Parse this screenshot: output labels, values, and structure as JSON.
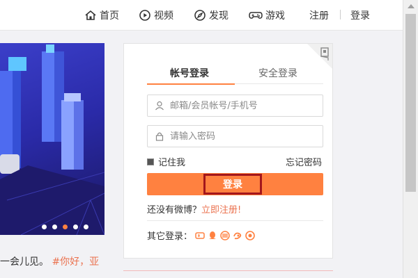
{
  "nav": {
    "home": "首页",
    "video": "视频",
    "discover": "发现",
    "game": "游戏",
    "register": "注册",
    "login": "登录"
  },
  "login_panel": {
    "tab_account": "帐号登录",
    "tab_secure": "安全登录",
    "username_placeholder": "邮箱/会员帐号/手机号",
    "password_placeholder": "请输入密码",
    "remember_me": "记住我",
    "forgot_password": "忘记密码",
    "login_button": "登录",
    "no_account_text": "还没有微博？",
    "register_link": "立即注册!",
    "other_login_label": "其它登录："
  },
  "feed": {
    "text": "一会儿见。",
    "tag": "#你好，亚"
  },
  "carousel": {
    "slide_count": 5,
    "active_index": 2
  },
  "colors": {
    "accent": "#ff8140",
    "link": "#eb7350",
    "highlight_border": "#a3161c"
  }
}
